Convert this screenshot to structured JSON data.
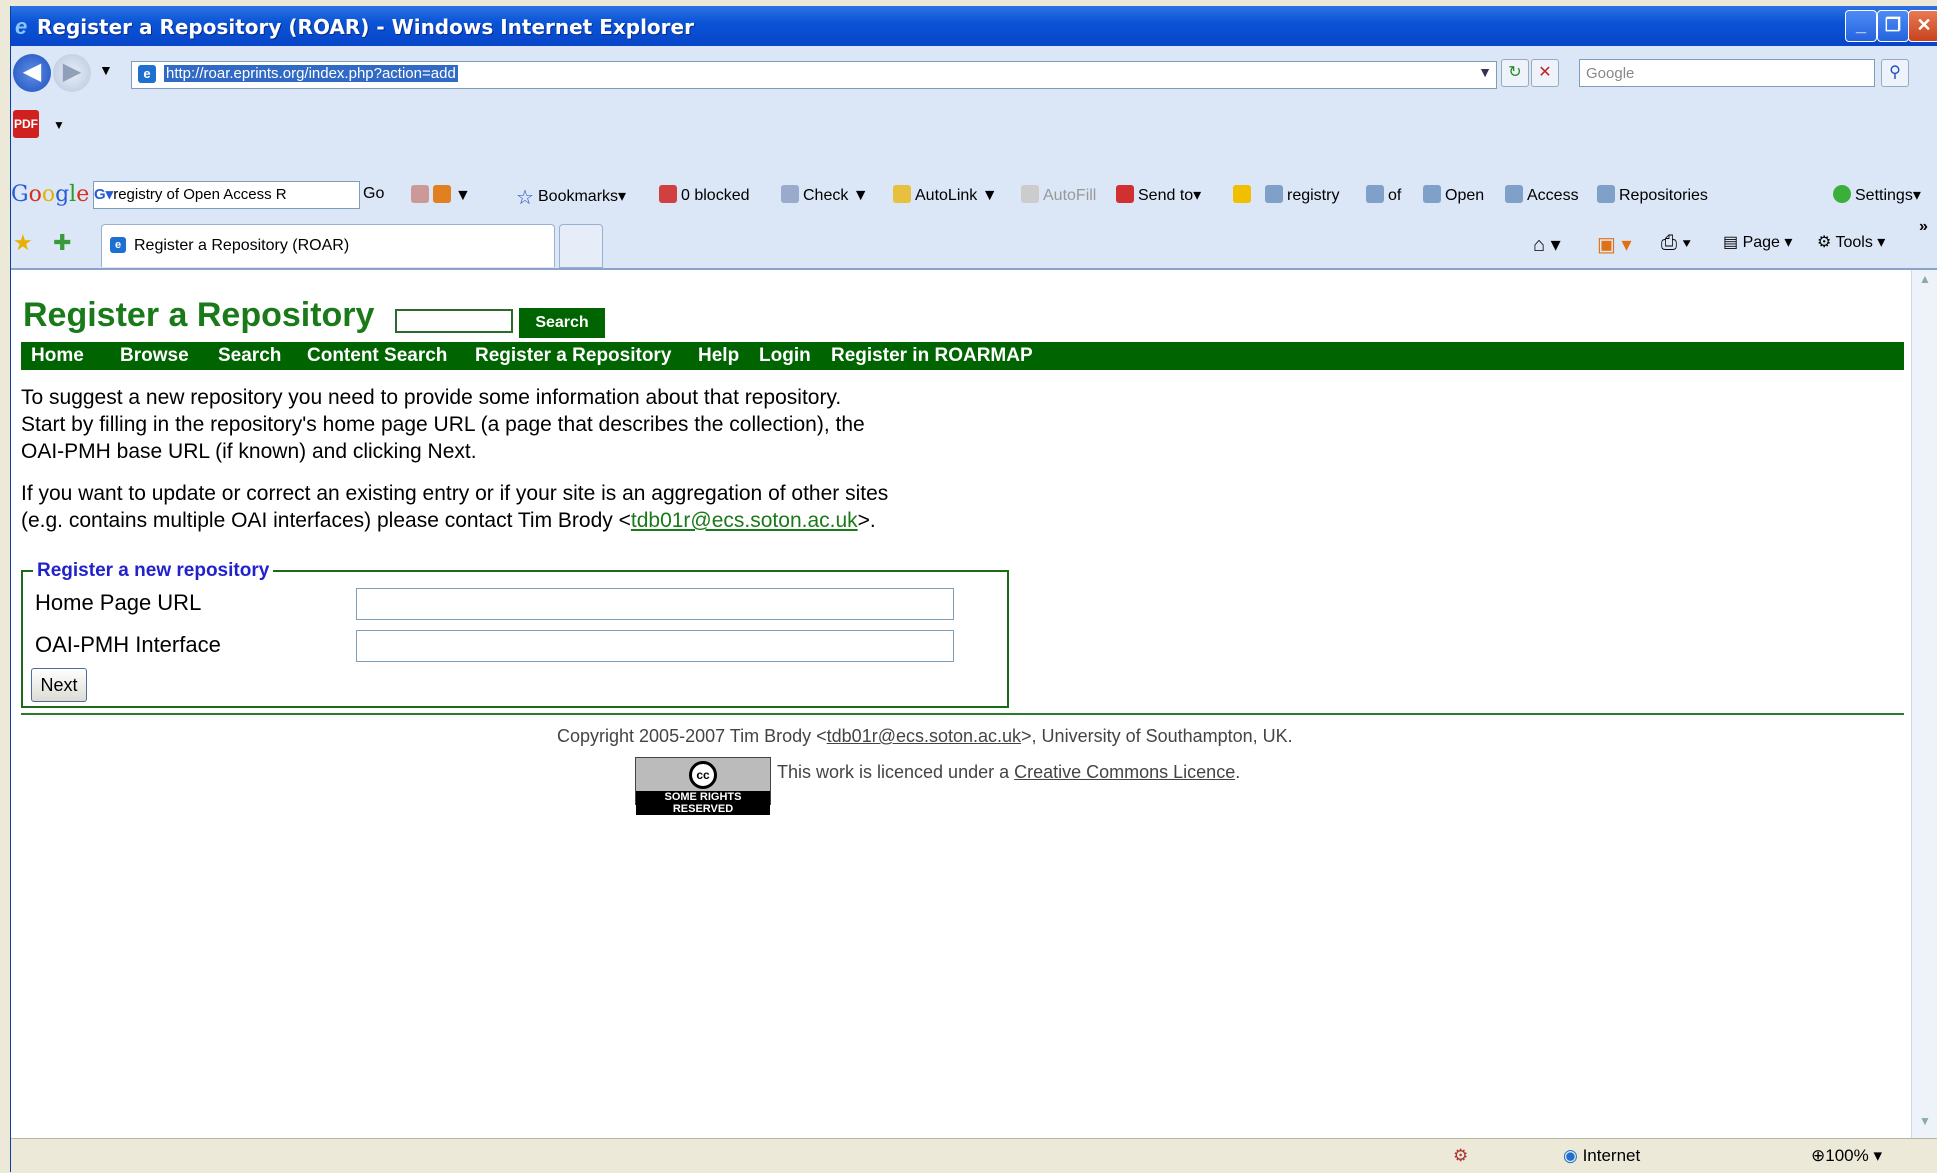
{
  "window": {
    "title": "Register a Repository (ROAR) - Windows Internet Explorer",
    "minimize": "_",
    "maximize": "❐",
    "close": "✕"
  },
  "address": {
    "url": "http://roar.eprints.org/index.php?action=add",
    "search_placeholder": "Google"
  },
  "google_toolbar": {
    "logo": "Google",
    "query": "registry of Open Access R",
    "go": "Go",
    "bookmarks": "Bookmarks",
    "blocked": "0 blocked",
    "check": "Check",
    "autolink": "AutoLink",
    "autofill": "AutoFill",
    "send_to": "Send to",
    "terms": [
      "registry",
      "of",
      "Open",
      "Access",
      "Repositories"
    ],
    "settings": "Settings"
  },
  "tab": {
    "title": "Register a Repository (ROAR)"
  },
  "command_bar": {
    "page": "Page",
    "tools": "Tools",
    "more": "»"
  },
  "page": {
    "heading": "Register a Repository",
    "search_button": "Search",
    "nav": [
      "Home",
      "Browse",
      "Search",
      "Content Search",
      "Register a Repository",
      "Help",
      "Login",
      "Register in ROARMAP"
    ],
    "para1": [
      "To suggest a new repository you need to provide some information about that repository.",
      "Start by filling in the repository's home page URL (a page that describes the collection), the",
      "OAI-PMH base URL (if known) and clicking Next."
    ],
    "para2_line1": "If you want to update or correct an existing entry or if your site is an aggregation of other sites",
    "para2_line2_pre": "(e.g. contains multiple OAI interfaces) please contact Tim Brody <",
    "contact_email": "tdb01r@ecs.soton.ac.uk",
    "para2_line2_post": ">.",
    "form": {
      "legend": "Register a new repository",
      "homepage_label": "Home Page URL",
      "homepage_value": "",
      "oai_label": "OAI-PMH Interface",
      "oai_value": "",
      "next": "Next"
    },
    "footer": {
      "copyright_pre": "Copyright 2005-2007 Tim Brody <",
      "email": "tdb01r@ecs.soton.ac.uk",
      "copyright_post": ">, University of Southampton, UK.",
      "cc_badge": "SOME RIGHTS RESERVED",
      "cc_logo": "cc",
      "licence_pre": "This work is licenced under a ",
      "licence_link": "Creative Commons Licence",
      "licence_post": "."
    }
  },
  "status": {
    "zone": "Internet",
    "zoom": "100%"
  }
}
